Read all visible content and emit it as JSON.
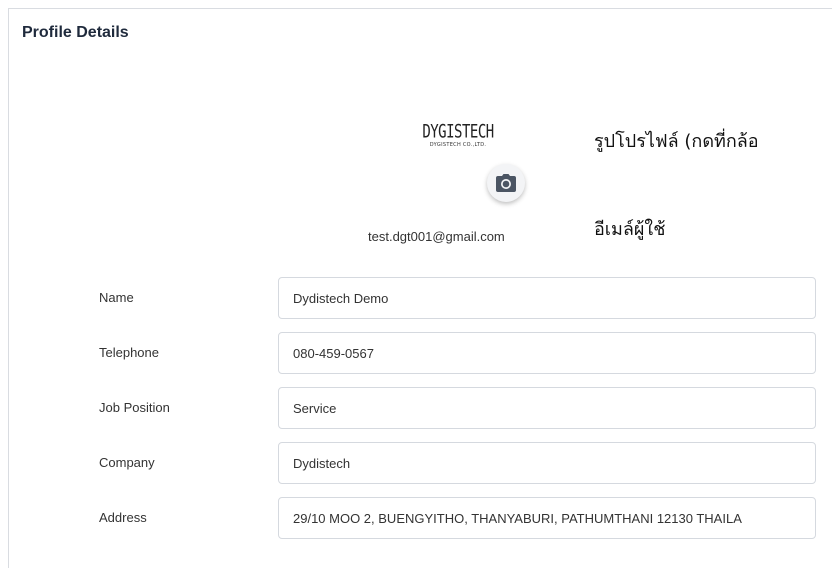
{
  "panel": {
    "title": "Profile Details"
  },
  "logo": {
    "main": "DYGISTECH",
    "sub": "DYGISTECH CO.,LTD."
  },
  "profile": {
    "email": "test.dgt001@gmail.com"
  },
  "annotations": {
    "photo_note": "รูปโปรไฟล์ (กดที่กล้อ",
    "email_note": "อีเมล์ผู้ใช้"
  },
  "fields": [
    {
      "label": "Name",
      "value": "Dydistech Demo"
    },
    {
      "label": "Telephone",
      "value": "080-459-0567"
    },
    {
      "label": "Job Position",
      "value": "Service"
    },
    {
      "label": "Company",
      "value": "Dydistech"
    },
    {
      "label": "Address",
      "value": "29/10 MOO 2, BUENGYITHO, THANYABURI, PATHUMTHANI 12130 THAILA"
    }
  ],
  "icons": {
    "camera": "camera-icon"
  }
}
